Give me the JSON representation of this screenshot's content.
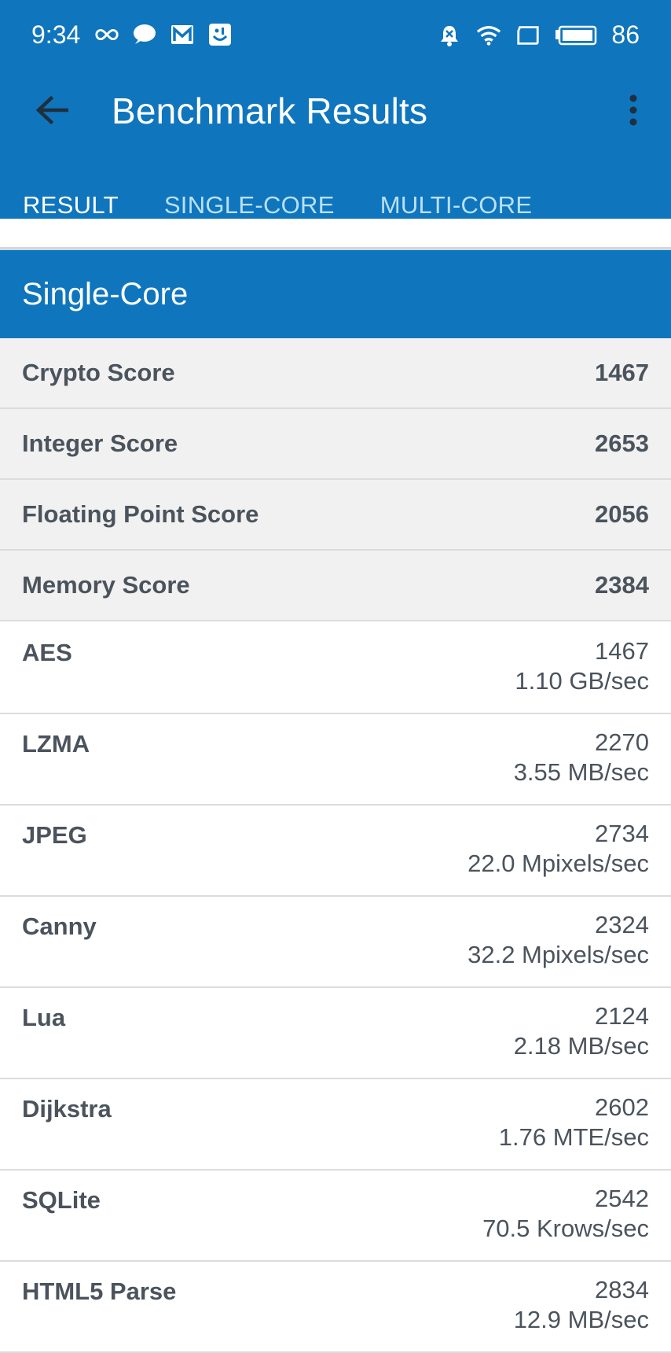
{
  "status_bar": {
    "time": "9:34",
    "battery": "86",
    "left_icons": [
      "infinity-icon",
      "chat-bubble-icon",
      "gmail-icon",
      "app-icon"
    ],
    "right_icons": [
      "alarm-off-icon",
      "wifi-icon",
      "screen-icon",
      "battery-icon"
    ]
  },
  "app_bar": {
    "title": "Benchmark Results",
    "back_icon": "arrow-left-icon",
    "menu_icon": "more-vert-icon"
  },
  "tabs": [
    {
      "label": "RESULT",
      "active": true
    },
    {
      "label": "SINGLE-CORE",
      "active": false
    },
    {
      "label": "MULTI-CORE",
      "active": false
    }
  ],
  "section": {
    "title": "Single-Core"
  },
  "summary": [
    {
      "label": "Crypto Score",
      "value": "1467"
    },
    {
      "label": "Integer Score",
      "value": "2653"
    },
    {
      "label": "Floating Point Score",
      "value": "2056"
    },
    {
      "label": "Memory Score",
      "value": "2384"
    }
  ],
  "details": [
    {
      "name": "AES",
      "score": "1467",
      "rate": "1.10 GB/sec"
    },
    {
      "name": "LZMA",
      "score": "2270",
      "rate": "3.55 MB/sec"
    },
    {
      "name": "JPEG",
      "score": "2734",
      "rate": "22.0 Mpixels/sec"
    },
    {
      "name": "Canny",
      "score": "2324",
      "rate": "32.2 Mpixels/sec"
    },
    {
      "name": "Lua",
      "score": "2124",
      "rate": "2.18 MB/sec"
    },
    {
      "name": "Dijkstra",
      "score": "2602",
      "rate": "1.76 MTE/sec"
    },
    {
      "name": "SQLite",
      "score": "2542",
      "rate": "70.5 Krows/sec"
    },
    {
      "name": "HTML5 Parse",
      "score": "2834",
      "rate": "12.9 MB/sec"
    }
  ],
  "colors": {
    "primary": "#0f75bd",
    "tab_inactive": "#b9e0f7",
    "summary_bg": "#f1f1f1",
    "text": "#4b535d"
  }
}
